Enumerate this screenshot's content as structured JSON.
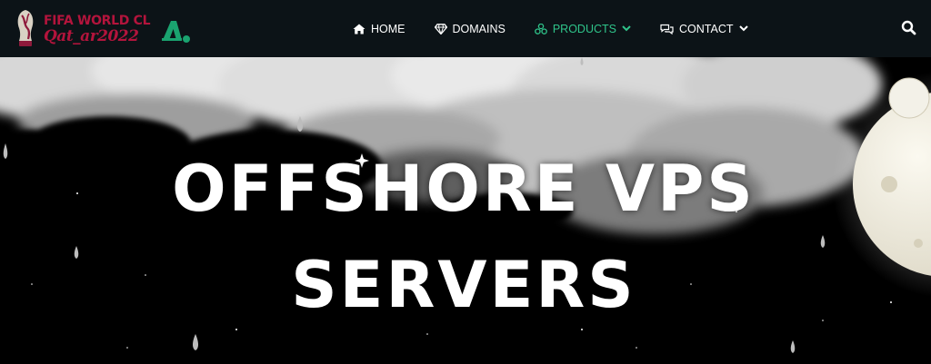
{
  "header": {
    "logo": {
      "line1": "FIFA WORLD CL",
      "line2": "Qat_ar2022"
    },
    "nav": [
      {
        "label": "HOME",
        "icon": "home-icon"
      },
      {
        "label": "DOMAINS",
        "icon": "diamond-icon"
      },
      {
        "label": "PRODUCTS",
        "icon": "cubes-icon",
        "active": true,
        "dropdown": true
      },
      {
        "label": "CONTACT",
        "icon": "chat-icon",
        "dropdown": true
      }
    ],
    "search_icon": "search-icon"
  },
  "hero": {
    "title_line1": "OFFSHORE VPS",
    "title_line2": "SERVERS"
  },
  "colors": {
    "nav_bg": "#0c1317",
    "accent": "#2fc48a",
    "logo_red": "#b3143c",
    "text": "#ffffff",
    "hero_bg": "#000000"
  }
}
